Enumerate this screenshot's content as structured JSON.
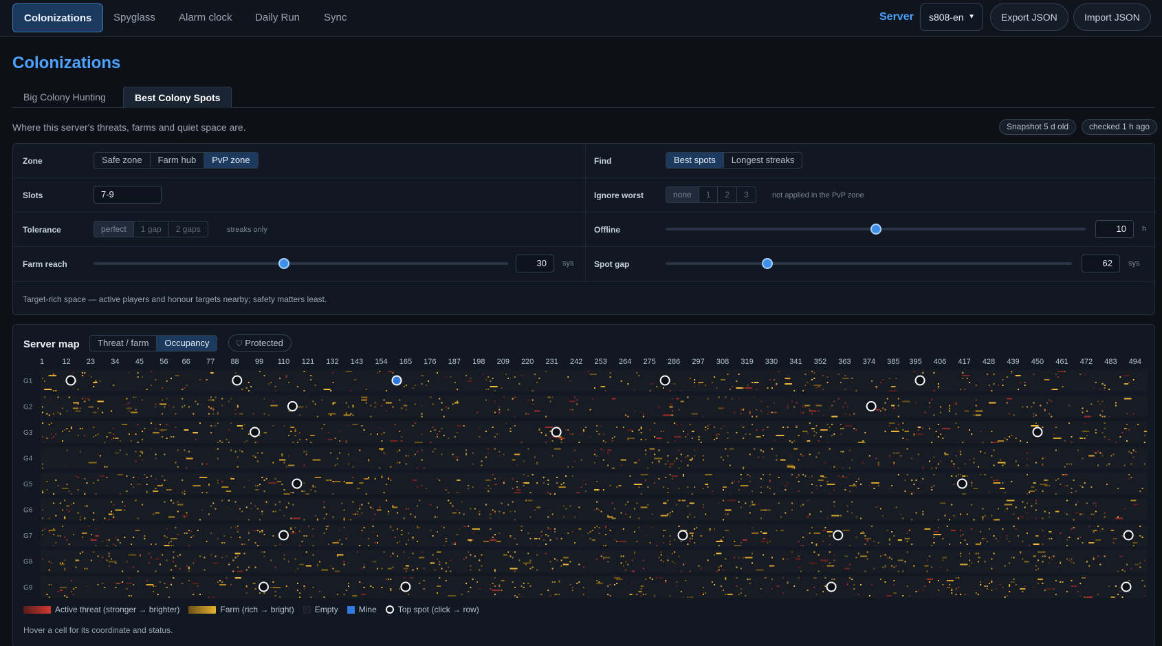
{
  "nav": {
    "tabs": [
      "Colonizations",
      "Spyglass",
      "Alarm clock",
      "Daily Run",
      "Sync"
    ],
    "active": 0,
    "server_label": "Server",
    "server_value": "s808-en",
    "export_label": "Export JSON",
    "import_label": "Import JSON"
  },
  "page": {
    "title": "Colonizations",
    "subtabs": [
      "Big Colony Hunting",
      "Best Colony Spots"
    ],
    "active_subtab": 1,
    "description": "Where this server's threats, farms and quiet space are.",
    "badges": [
      "Snapshot 5 d old",
      "checked 1 h ago"
    ]
  },
  "controls": {
    "zone": {
      "label": "Zone",
      "options": [
        "Safe zone",
        "Farm hub",
        "PvP zone"
      ],
      "selected": 2
    },
    "find": {
      "label": "Find",
      "options": [
        "Best spots",
        "Longest streaks"
      ],
      "selected": 0
    },
    "slots": {
      "label": "Slots",
      "value": "7-9"
    },
    "ignore_worst": {
      "label": "Ignore worst",
      "options": [
        "none",
        "1",
        "2",
        "3"
      ],
      "selected": 0,
      "note": "not applied in the PvP zone"
    },
    "tolerance": {
      "label": "Tolerance",
      "options": [
        "perfect",
        "1 gap",
        "2 gaps"
      ],
      "selected": 0,
      "note": "streaks only"
    },
    "offline": {
      "label": "Offline",
      "value": "10",
      "unit": "h",
      "fraction": 0.5
    },
    "farm_reach": {
      "label": "Farm reach",
      "value": "30",
      "unit": "sys",
      "fraction": 0.46
    },
    "spot_gap": {
      "label": "Spot gap",
      "value": "62",
      "unit": "sys",
      "fraction": 0.25
    },
    "help": "Target-rich space — active players and honour targets nearby; safety matters least."
  },
  "map": {
    "title": "Server map",
    "modes": [
      "Threat / farm",
      "Occupancy"
    ],
    "mode_selected": 1,
    "protected_label": "Protected",
    "axis_ticks": [
      1,
      12,
      23,
      34,
      45,
      56,
      66,
      77,
      88,
      99,
      110,
      121,
      132,
      143,
      154,
      165,
      176,
      187,
      198,
      209,
      220,
      231,
      242,
      253,
      264,
      275,
      286,
      297,
      308,
      319,
      330,
      341,
      352,
      363,
      374,
      385,
      395,
      406,
      417,
      428,
      439,
      450,
      461,
      472,
      483,
      494
    ],
    "galaxies": [
      "G1",
      "G2",
      "G3",
      "G4",
      "G5",
      "G6",
      "G7",
      "G8",
      "G9"
    ],
    "top_spots": [
      {
        "galaxy": "G1",
        "system": 14
      },
      {
        "galaxy": "G1",
        "system": 89
      },
      {
        "galaxy": "G1",
        "system": 161,
        "mine": true
      },
      {
        "galaxy": "G1",
        "system": 282
      },
      {
        "galaxy": "G1",
        "system": 397
      },
      {
        "galaxy": "G2",
        "system": 114
      },
      {
        "galaxy": "G2",
        "system": 375
      },
      {
        "galaxy": "G3",
        "system": 97
      },
      {
        "galaxy": "G3",
        "system": 233
      },
      {
        "galaxy": "G3",
        "system": 450
      },
      {
        "galaxy": "G5",
        "system": 116
      },
      {
        "galaxy": "G5",
        "system": 416
      },
      {
        "galaxy": "G7",
        "system": 110
      },
      {
        "galaxy": "G7",
        "system": 290
      },
      {
        "galaxy": "G7",
        "system": 360
      },
      {
        "galaxy": "G7",
        "system": 491
      },
      {
        "galaxy": "G9",
        "system": 101
      },
      {
        "galaxy": "G9",
        "system": 165
      },
      {
        "galaxy": "G9",
        "system": 357
      },
      {
        "galaxy": "G9",
        "system": 490
      }
    ],
    "legend": {
      "threat": "Active threat (stronger → brighter)",
      "farm": "Farm (rich → bright)",
      "empty": "Empty",
      "mine": "Mine",
      "top": "Top spot (click → row)"
    },
    "colors": {
      "threat": "#c0392b",
      "farm": "#e0a526",
      "empty": "#1a1f27",
      "mine": "#2f7be0",
      "ring": "#ffffff"
    },
    "hover_hint": "Hover a cell for its coordinate and status."
  }
}
